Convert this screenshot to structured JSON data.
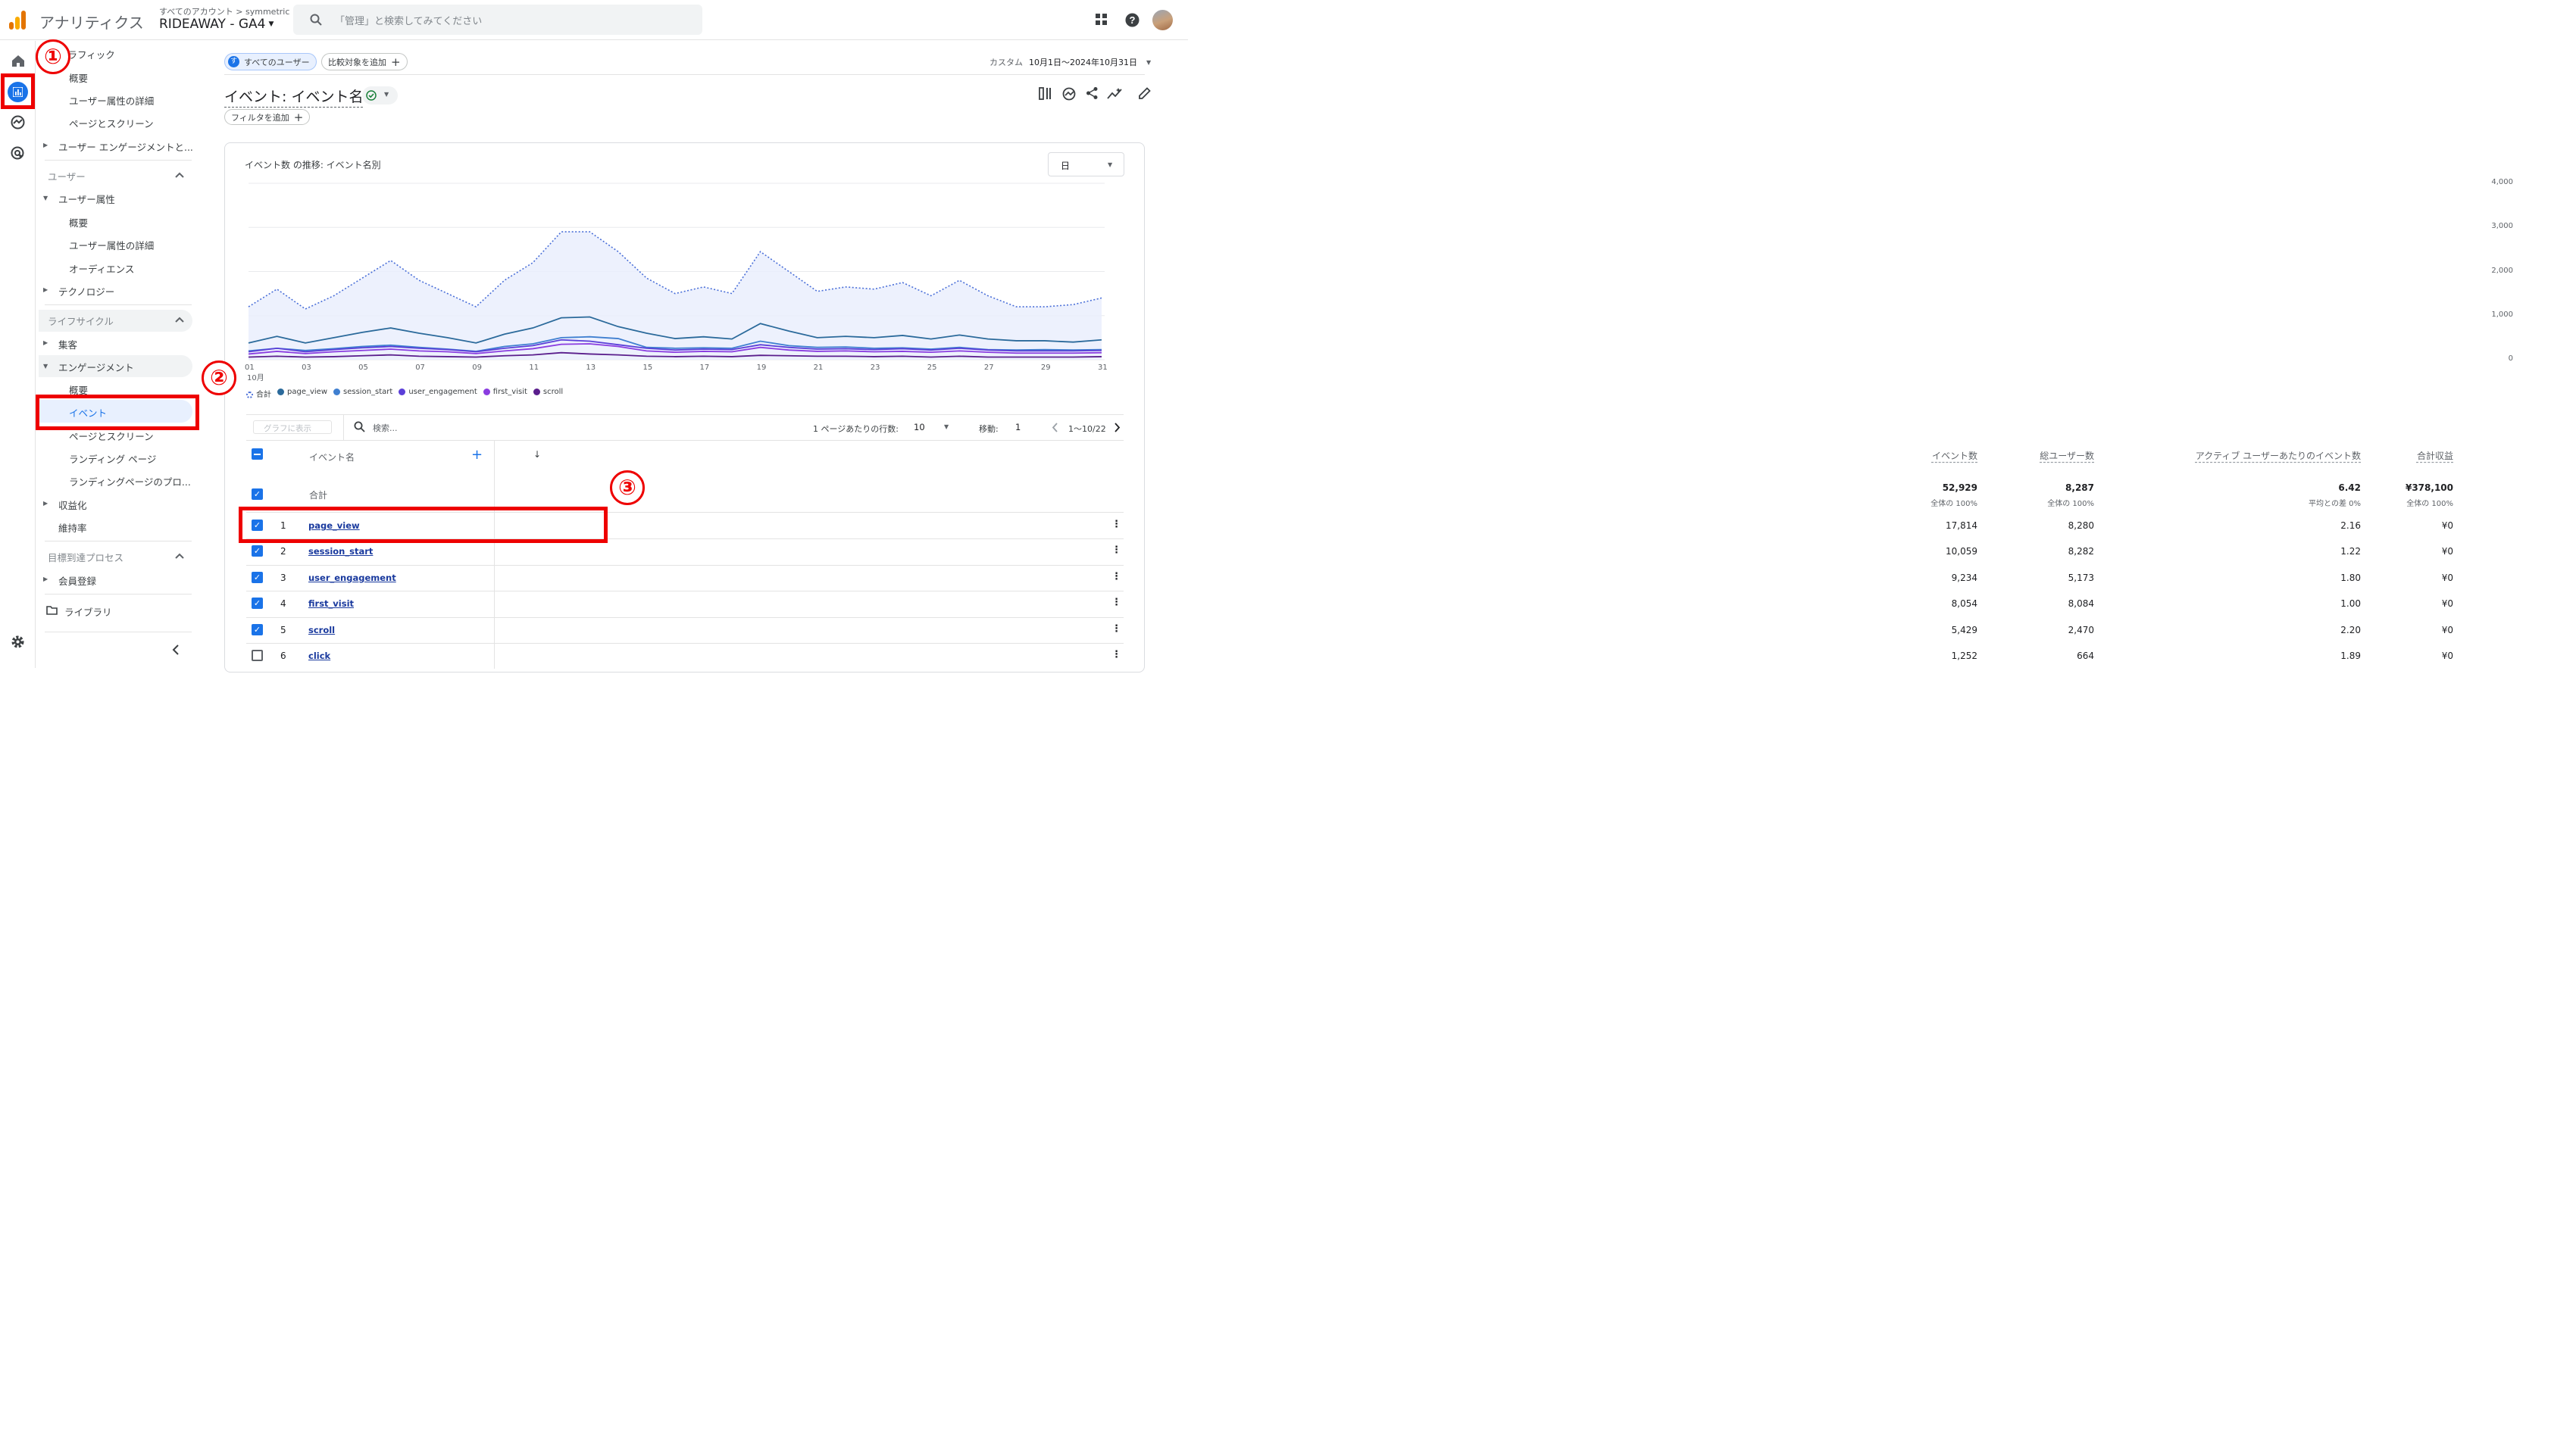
{
  "topbar": {
    "app_name": "アナリティクス",
    "account_path": "すべてのアカウント > symmetric",
    "property": "RIDEAWAY - GA4",
    "search_placeholder": "「管理」と検索してみてください"
  },
  "nav": {
    "items": [
      {
        "label": "トラフィック"
      },
      {
        "label": "概要"
      },
      {
        "label": "ユーザー属性の詳細"
      },
      {
        "label": "ページとスクリーン"
      },
      {
        "label": "ユーザー エンゲージメントと..."
      },
      {
        "label": "ユーザー"
      },
      {
        "label": "ユーザー属性"
      },
      {
        "label": "概要"
      },
      {
        "label": "ユーザー属性の詳細"
      },
      {
        "label": "オーディエンス"
      },
      {
        "label": "テクノロジー"
      },
      {
        "label": "ライフサイクル"
      },
      {
        "label": "集客"
      },
      {
        "label": "エンゲージメント"
      },
      {
        "label": "概要"
      },
      {
        "label": "イベント"
      },
      {
        "label": "ページとスクリーン"
      },
      {
        "label": "ランディング ページ"
      },
      {
        "label": "ランディングページのプロ..."
      },
      {
        "label": "収益化"
      },
      {
        "label": "維持率"
      },
      {
        "label": "目標到達プロセス"
      },
      {
        "label": "会員登録"
      },
      {
        "label": "ライブラリ"
      }
    ]
  },
  "header": {
    "segment_chip": "すべてのユーザー",
    "segment_avatar": "す",
    "compare_chip": "比較対象を追加",
    "date_label": "カスタム",
    "date_range": "10月1日～2024年10月31日",
    "title": "イベント: イベント名",
    "filter_chip": "フィルタを追加"
  },
  "chart": {
    "title": "イベント数 の推移: イベント名別",
    "granularity": "日",
    "legend": [
      {
        "name": "合計",
        "color": "#4a6fd8"
      },
      {
        "name": "page_view",
        "color": "#2b6a9b"
      },
      {
        "name": "session_start",
        "color": "#3f7fd0"
      },
      {
        "name": "user_engagement",
        "color": "#5b3fd8"
      },
      {
        "name": "first_visit",
        "color": "#8a3ce0"
      },
      {
        "name": "scroll",
        "color": "#5a1e8c"
      }
    ],
    "x_ticks": [
      "01",
      "03",
      "05",
      "07",
      "09",
      "11",
      "13",
      "15",
      "17",
      "19",
      "21",
      "23",
      "25",
      "27",
      "29",
      "31"
    ],
    "x_sub": "10月",
    "y_ticks": [
      "4,000",
      "3,000",
      "2,000",
      "1,000",
      "0"
    ]
  },
  "chart_data": {
    "type": "line",
    "x": [
      1,
      2,
      3,
      4,
      5,
      6,
      7,
      8,
      9,
      10,
      11,
      12,
      13,
      14,
      15,
      16,
      17,
      18,
      19,
      20,
      21,
      22,
      23,
      24,
      25,
      26,
      27,
      28,
      29,
      30,
      31
    ],
    "ylim": [
      0,
      4000
    ],
    "series": [
      {
        "name": "合計",
        "values": [
          1200,
          1600,
          1150,
          1450,
          1850,
          2250,
          1800,
          1500,
          1200,
          1800,
          2200,
          2900,
          2900,
          2450,
          1850,
          1500,
          1650,
          1500,
          2450,
          2000,
          1550,
          1650,
          1600,
          1750,
          1450,
          1800,
          1450,
          1200,
          1200,
          1250,
          1400
        ]
      },
      {
        "name": "page_view",
        "values": [
          380,
          530,
          380,
          500,
          620,
          720,
          600,
          500,
          380,
          580,
          720,
          950,
          970,
          750,
          600,
          480,
          520,
          470,
          820,
          650,
          500,
          530,
          500,
          550,
          470,
          560,
          470,
          430,
          430,
          400,
          450
        ]
      },
      {
        "name": "session_start",
        "values": [
          200,
          260,
          210,
          250,
          300,
          330,
          280,
          240,
          190,
          300,
          360,
          500,
          520,
          480,
          280,
          260,
          270,
          260,
          420,
          320,
          280,
          290,
          260,
          270,
          240,
          280,
          230,
          220,
          230,
          220,
          230
        ]
      },
      {
        "name": "user_engagement",
        "values": [
          180,
          260,
          180,
          230,
          270,
          300,
          260,
          230,
          180,
          260,
          320,
          450,
          420,
          340,
          260,
          220,
          240,
          230,
          340,
          280,
          240,
          250,
          230,
          250,
          220,
          260,
          220,
          200,
          200,
          200,
          210
        ]
      },
      {
        "name": "first_visit",
        "values": [
          130,
          190,
          140,
          180,
          210,
          240,
          200,
          180,
          140,
          200,
          250,
          350,
          360,
          300,
          200,
          170,
          190,
          180,
          280,
          220,
          190,
          200,
          180,
          190,
          170,
          200,
          170,
          150,
          150,
          150,
          160
        ]
      },
      {
        "name": "scroll",
        "values": [
          60,
          80,
          60,
          70,
          90,
          110,
          80,
          70,
          60,
          90,
          110,
          160,
          130,
          110,
          80,
          70,
          80,
          70,
          100,
          90,
          80,
          80,
          70,
          80,
          60,
          80,
          60,
          60,
          60,
          60,
          70
        ]
      }
    ]
  },
  "table": {
    "toolbar": {
      "graph_btn": "グラフに表示",
      "search_placeholder": "検索...",
      "rows_label": "1 ページあたりの行数:",
      "rows_value": "10",
      "goto_label": "移動:",
      "goto_value": "1",
      "range": "1～10/22"
    },
    "headers": [
      "イベント名",
      "イベント数",
      "総ユーザー数",
      "アクティブ ユーザーあたりのイベント数",
      "合計収益"
    ],
    "total": {
      "label": "合計",
      "events": "52,929",
      "events_sub": "全体の 100%",
      "users": "8,287",
      "users_sub": "全体の 100%",
      "per_user": "6.42",
      "per_user_sub": "平均との差 0%",
      "revenue": "¥378,100",
      "revenue_sub": "全体の 100%"
    },
    "rows": [
      {
        "idx": "1",
        "name": "page_view",
        "events": "17,814",
        "users": "8,280",
        "per_user": "2.16",
        "revenue": "¥0",
        "checked": true
      },
      {
        "idx": "2",
        "name": "session_start",
        "events": "10,059",
        "users": "8,282",
        "per_user": "1.22",
        "revenue": "¥0",
        "checked": true
      },
      {
        "idx": "3",
        "name": "user_engagement",
        "events": "9,234",
        "users": "5,173",
        "per_user": "1.80",
        "revenue": "¥0",
        "checked": true
      },
      {
        "idx": "4",
        "name": "first_visit",
        "events": "8,054",
        "users": "8,084",
        "per_user": "1.00",
        "revenue": "¥0",
        "checked": true
      },
      {
        "idx": "5",
        "name": "scroll",
        "events": "5,429",
        "users": "2,470",
        "per_user": "2.20",
        "revenue": "¥0",
        "checked": true
      },
      {
        "idx": "6",
        "name": "click",
        "events": "1,252",
        "users": "664",
        "per_user": "1.89",
        "revenue": "¥0",
        "checked": false
      }
    ]
  },
  "annotations": [
    "①",
    "②",
    "③"
  ]
}
